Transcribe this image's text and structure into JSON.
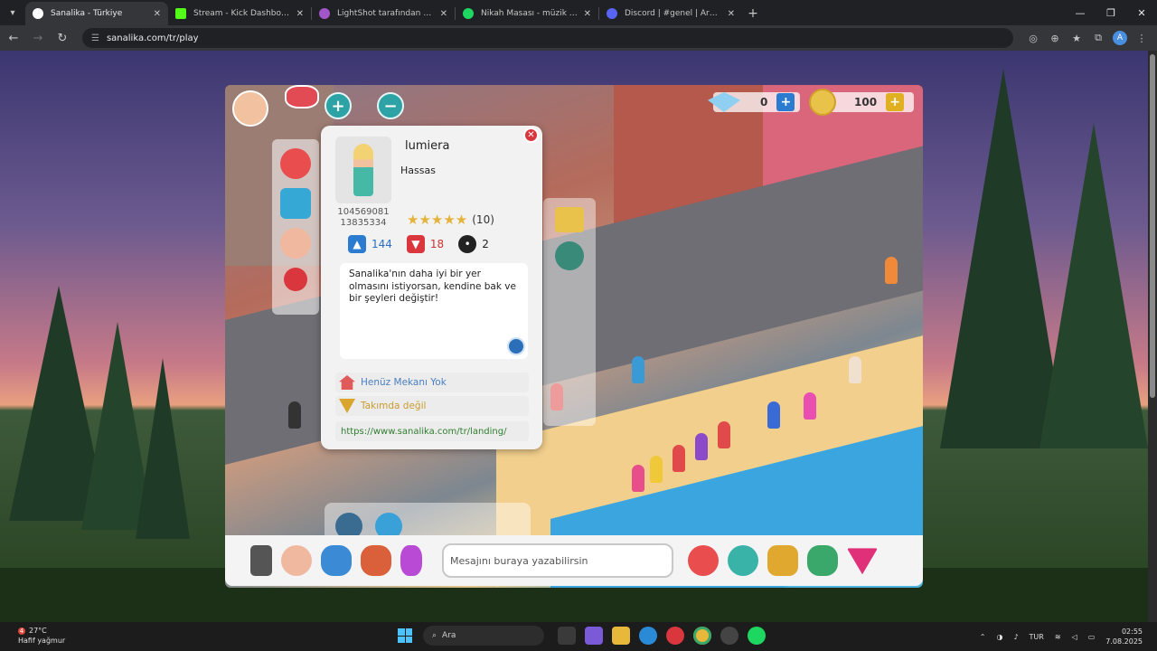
{
  "browser": {
    "tabs": [
      {
        "title": "Sanalika - Türkiye",
        "color": "#ffffff",
        "active": true
      },
      {
        "title": "Stream - Kick Dashboard",
        "color": "#53fc18",
        "active": false
      },
      {
        "title": "LightShot tarafından Ekran Görü",
        "color": "#a256c8",
        "active": false
      },
      {
        "title": "Nikah Masası - müzik ve şarkı s",
        "color": "#1ed760",
        "active": false
      },
      {
        "title": "Discord | #genel | Arkadaşlarım.",
        "color": "#5865f2",
        "active": false
      }
    ],
    "url": "sanalika.com/tr/play",
    "profile_initial": "A"
  },
  "game": {
    "currency": {
      "gems": "0",
      "coins": "100"
    },
    "profile": {
      "username": "lumiera",
      "role": "Hassas",
      "id_line1": "104569081",
      "id_line2": "13835334",
      "stars_glyph": "★★★★★",
      "rating_count": "(10)",
      "likes": "144",
      "dislikes": "18",
      "neutral": "2",
      "bio": "Sanalika'nın daha iyi bir yer olmasını istiyorsan, kendine bak ve bir şeyleri değiştir!",
      "home": "Henüz Mekanı Yok",
      "team": "Takımda değil",
      "link": "https://www.sanalika.com/tr/landing/"
    },
    "chat_placeholder": "Mesajını buraya yazabilirsin"
  },
  "taskbar": {
    "weather_temp": "27°C",
    "weather_desc": "Hafif yağmur",
    "weather_alert": "4",
    "search_label": "Ara",
    "lang": "TUR",
    "time": "02:55",
    "date": "7.08.2025"
  }
}
